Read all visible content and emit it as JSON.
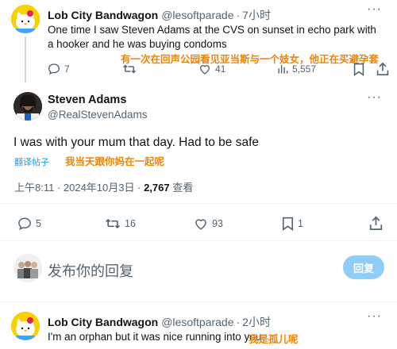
{
  "tweet1": {
    "display_name": "Lob City Bandwagon",
    "handle": "@lesoftparade",
    "separator": "·",
    "time": "7小时",
    "text": "One time I saw Steven Adams at the CVS on sunset in echo park with a hooker and he was buying condoms",
    "overlay": "有一次在回声公园看见亚当斯与一个妓女，他正在买避孕套",
    "replies": "7",
    "views": "5,557",
    "likes": "41"
  },
  "main": {
    "display_name": "Steven Adams",
    "handle": "@RealStevenAdams",
    "text": "I was with your mum that day. Had to be safe",
    "translate_label": "翻译帖子",
    "overlay": "我当天跟你妈在一起呢",
    "timestamp": "上午8:11 · 2024年10月3日 · ",
    "view_count": "2,767",
    "view_label": " 查看",
    "replies": "5",
    "retweets": "16",
    "likes": "93",
    "bookmarks": "1"
  },
  "reply_box": {
    "placeholder": "发布你的回复",
    "button_label": "回复"
  },
  "tweet3": {
    "display_name": "Lob City Bandwagon",
    "handle": "@lesoftparade",
    "separator": "·",
    "time": "2小时",
    "text": "I'm an orphan but it was nice running into you",
    "overlay": "我是孤儿呢"
  },
  "icons": {
    "reply": "reply-icon",
    "retweet": "retweet-icon",
    "like": "heart-icon",
    "views": "analytics-icon",
    "bookmark": "bookmark-icon",
    "share": "share-icon",
    "more": "more-icon"
  },
  "colors": {
    "accent": "#1d9bf0",
    "overlay": "#f0840a",
    "secondary_text": "#536471"
  }
}
